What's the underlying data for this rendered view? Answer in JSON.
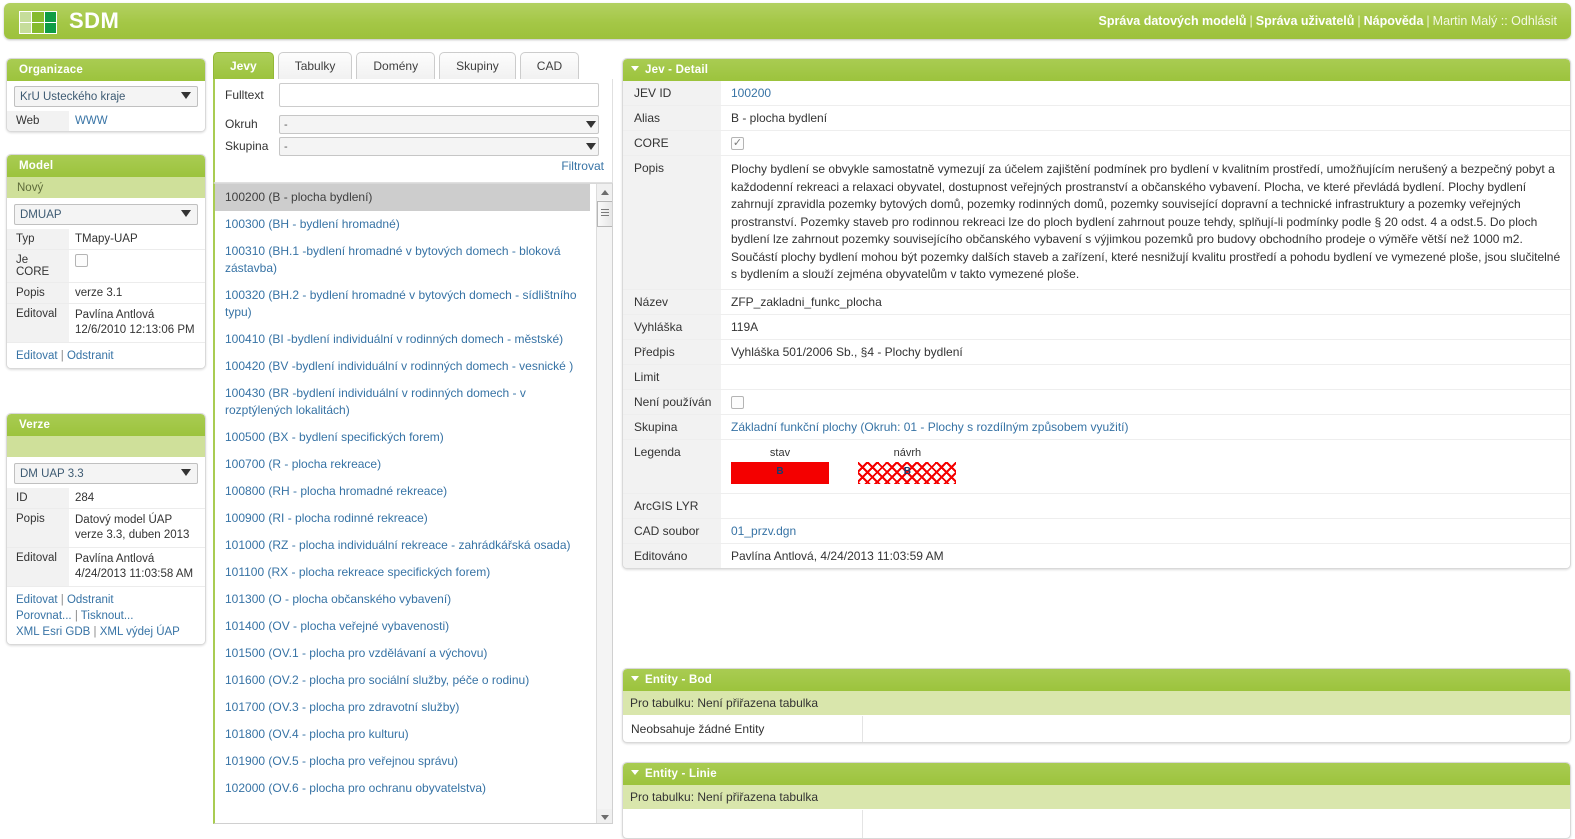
{
  "app": {
    "brand": "SDM",
    "nav": [
      {
        "label": "Správa datových modelů",
        "bold": true
      },
      {
        "label": "Správa uživatelů",
        "bold": true
      },
      {
        "label": "Nápověda",
        "bold": true
      }
    ],
    "user": "Martin Malý :: Odhlásit",
    "separator": "|"
  },
  "sidebar": {
    "organizace": {
      "title": "Organizace",
      "select_value": "KrÚ Ústeckého kraje",
      "rows": [
        {
          "key": "Web",
          "value": "WWW"
        }
      ]
    },
    "model": {
      "title": "Model",
      "new_label": "Nový",
      "select_value": "DMUAP",
      "rows": [
        {
          "key": "Typ",
          "value": "TMapy-UAP"
        },
        {
          "key": "Je CORE",
          "value": ""
        },
        {
          "key": "Popis",
          "value": "verze 3.1"
        },
        {
          "key": "Editoval",
          "value": "Pavlína Antlová\n12/6/2010 12:13:06 PM"
        }
      ],
      "actions": [
        "Editovat",
        "Odstranit"
      ]
    },
    "verze": {
      "title": "Verze",
      "select_value": "DM UAP 3.3",
      "rows": [
        {
          "key": "ID",
          "value": "284"
        },
        {
          "key": "Popis",
          "value": "Datový model ÚAP\nverze 3.3, duben 2013"
        },
        {
          "key": "Editoval",
          "value": "Pavlína Antlová\n4/24/2013 11:03:58 AM"
        }
      ],
      "actions_line1": [
        "Editovat",
        "Odstranit"
      ],
      "actions_line2": [
        "Porovnat...",
        "Tisknout..."
      ],
      "actions_line3": [
        "XML Esri GDB",
        "XML výdej ÚAP"
      ]
    }
  },
  "tabs": [
    {
      "label": "Jevy",
      "active": true
    },
    {
      "label": "Tabulky",
      "active": false
    },
    {
      "label": "Domény",
      "active": false
    },
    {
      "label": "Skupiny",
      "active": false
    },
    {
      "label": "CAD",
      "active": false
    }
  ],
  "filter": {
    "fulltext_label": "Fulltext",
    "fulltext_value": "",
    "okruh_label": "Okruh",
    "okruh_value": "-",
    "skupina_label": "Skupina",
    "skupina_value": "-",
    "submit_label": "Filtrovat"
  },
  "list": {
    "items": [
      {
        "text": "100200 (B - plocha bydlení)",
        "selected": true
      },
      {
        "text": "100300 (BH - bydlení hromadné)",
        "selected": false
      },
      {
        "text": "100310 (BH.1 -bydlení hromadné v bytových domech - bloková zástavba)",
        "selected": false
      },
      {
        "text": "100320 (BH.2 - bydlení hromadné v bytových domech - sídlištního typu)",
        "selected": false
      },
      {
        "text": "100410 (BI -bydlení individuální v rodinných domech - městské)",
        "selected": false
      },
      {
        "text": "100420 (BV -bydlení individuální v rodinných domech - vesnické )",
        "selected": false
      },
      {
        "text": "100430 (BR -bydlení individuální v rodinných domech - v rozptýlených lokalitách)",
        "selected": false
      },
      {
        "text": "100500 (BX - bydlení specifických forem)",
        "selected": false
      },
      {
        "text": "100700 (R - plocha rekreace)",
        "selected": false
      },
      {
        "text": "100800 (RH - plocha hromadné rekreace)",
        "selected": false
      },
      {
        "text": "100900 (RI - plocha rodinné rekreace)",
        "selected": false
      },
      {
        "text": "101000 (RZ - plocha individuální rekreace - zahrádkářská osada)",
        "selected": false
      },
      {
        "text": "101100 (RX - plocha rekreace specifických forem)",
        "selected": false
      },
      {
        "text": "101300 (O - plocha občanského vybavení)",
        "selected": false
      },
      {
        "text": "101400 (OV - plocha veřejné vybavenosti)",
        "selected": false
      },
      {
        "text": "101500 (OV.1 - plocha pro vzdělávaní a výchovu)",
        "selected": false
      },
      {
        "text": "101600 (OV.2 - plocha pro sociální služby, péče o rodinu)",
        "selected": false
      },
      {
        "text": "101700 (OV.3 - plocha pro zdravotní služby)",
        "selected": false
      },
      {
        "text": "101800 (OV.4 - plocha pro kulturu)",
        "selected": false
      },
      {
        "text": "101900 (OV.5 - plocha pro veřejnou správu)",
        "selected": false
      },
      {
        "text": "102000 (OV.6 - plocha pro ochranu obyvatelstva)",
        "selected": false
      }
    ]
  },
  "detail": {
    "title": "Jev - Detail",
    "jev_id_label": "JEV ID",
    "jev_id": "100200",
    "alias_label": "Alias",
    "alias": "B - plocha bydlení",
    "core_label": "CORE",
    "core_checked": true,
    "popis_label": "Popis",
    "popis": "Plochy bydlení se obvykle samostatně vymezují za účelem zajištění podmínek pro bydlení v kvalitním prostředí, umožňujícím nerušený a bezpečný pobyt a každodenní rekreaci a relaxaci obyvatel, dostupnost veřejných prostranství a občanského vybavení. Plocha, ve které převládá bydlení. Plochy bydlení zahrnují zpravidla pozemky bytových domů, pozemky rodinných domů, pozemky související dopravní a technické infrastruktury a pozemky veřejných prostranství. Pozemky staveb pro rodinnou rekreaci lze do ploch bydlení zahrnout pouze tehdy, splňují-li podmínky podle § 20 odst. 4 a odst.5. Do ploch bydlení lze zahrnout pozemky souvisejícího občanského vybavení s výjimkou pozemků pro budovy obchodního prodeje o výměře větší než 1000 m2. Součástí plochy bydlení mohou být pozemky dalších staveb a zařízení, které nesnižují kvalitu prostředí a pohodu bydlení ve vymezené ploše, jsou slučitelné s bydlením a slouží zejména obyvatelům v takto vymezené ploše.",
    "nazev_label": "Název",
    "nazev": "ZFP_zakladni_funkc_plocha",
    "vyhlaska_label": "Vyhláška",
    "vyhlaska": "119A",
    "predpis_label": "Předpis",
    "predpis": "Vyhláška 501/2006 Sb., §4 - Plochy bydlení",
    "limit_label": "Limit",
    "limit": "",
    "neni_pouzivan_label": "Není používán",
    "neni_pouzivan_checked": false,
    "skupina_label": "Skupina",
    "skupina": "Základní funkční plochy (Okruh: 01 - Plochy s rozdílným způsobem využití)",
    "legenda_label": "Legenda",
    "legenda": [
      {
        "title": "stav",
        "code": "B",
        "style": "solid",
        "color": "#f40000"
      },
      {
        "title": "návrh",
        "code": "B",
        "style": "hatch",
        "color": "#f40000"
      }
    ],
    "arcgis_label": "ArcGIS LYR",
    "arcgis": "",
    "cad_label": "CAD soubor",
    "cad": "01_przv.dgn",
    "editovano_label": "Editováno",
    "editovano": "Pavlína Antlová, 4/24/2013 11:03:59 AM"
  },
  "entity_bod": {
    "title": "Entity - Bod",
    "subline": "Pro tabulku: Není přiřazena tabulka",
    "empty": "Neobsahuje žádné Entity"
  },
  "entity_linie": {
    "title": "Entity - Linie",
    "subline": "Pro tabulku: Není přiřazena tabulka"
  },
  "colors": {
    "brand_green": "#9cc33d",
    "header_green": "#a9cc52",
    "subhead_green": "#cfe09a",
    "link_blue": "#3773a5",
    "legend_red": "#f40000"
  }
}
